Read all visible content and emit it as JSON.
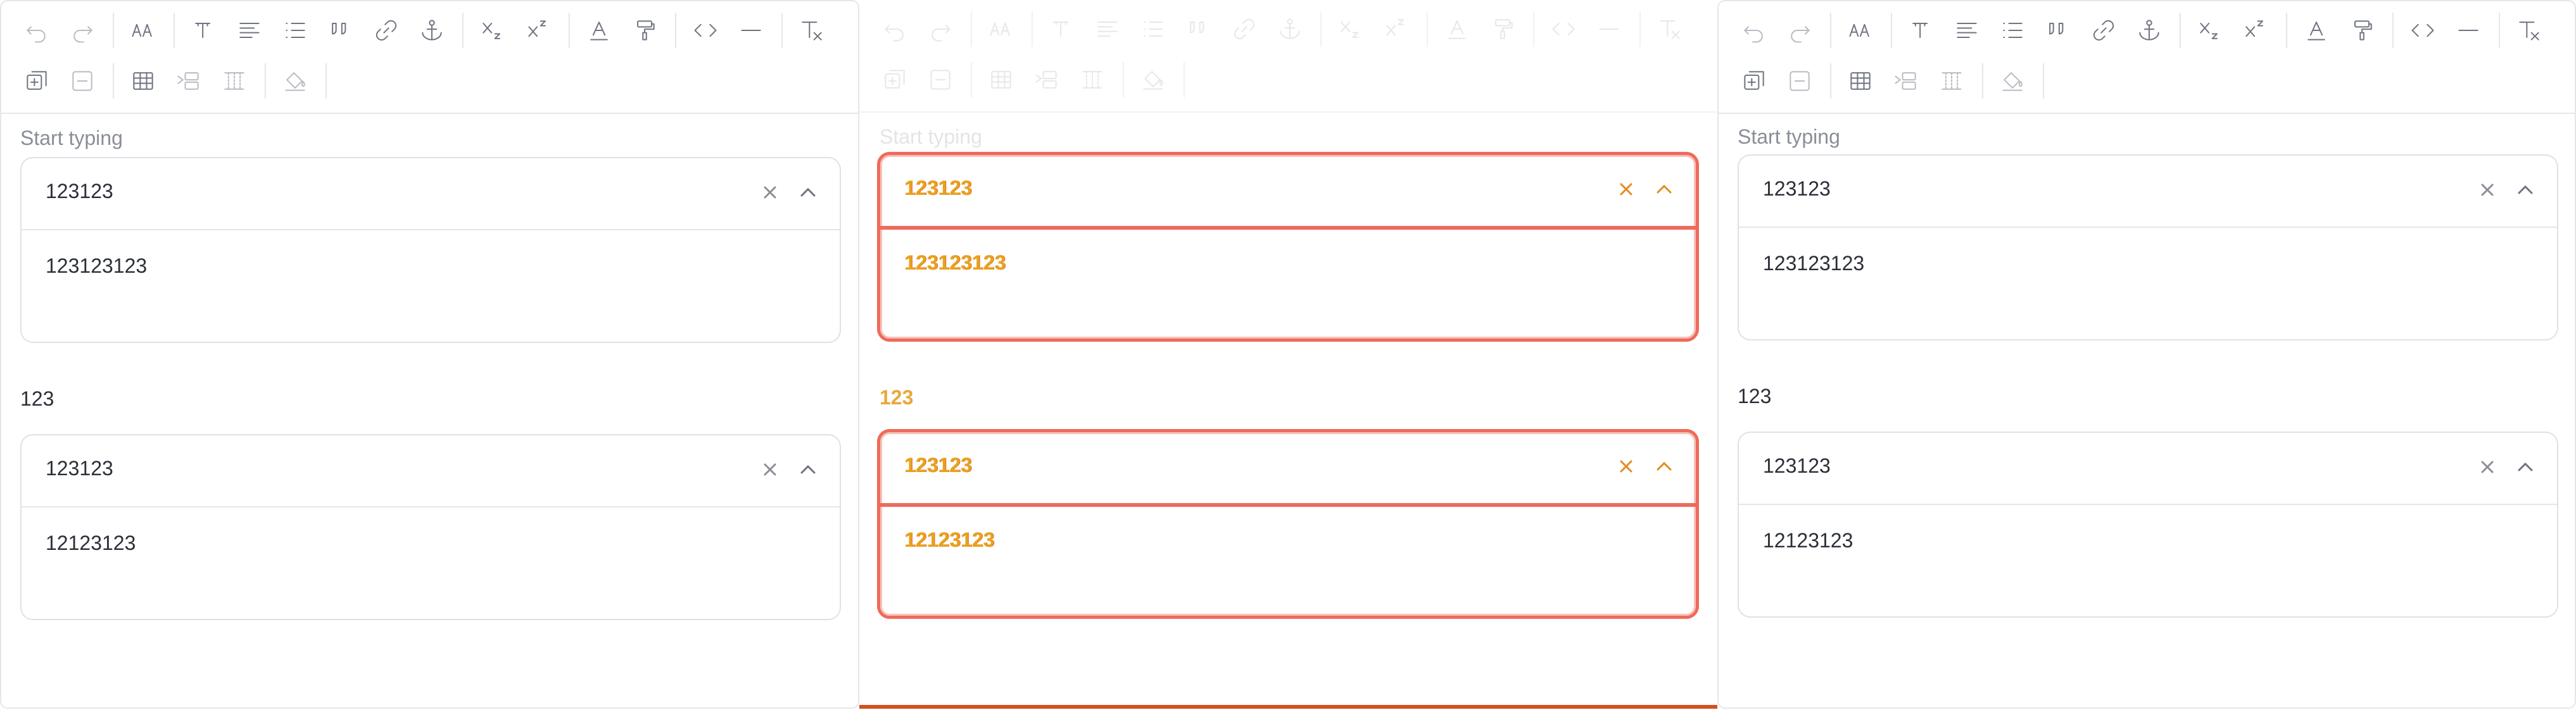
{
  "toolbar": {
    "row1": [
      {
        "icon": "undo-icon",
        "disabled": true
      },
      {
        "icon": "redo-icon",
        "disabled": true
      },
      {
        "sep": true
      },
      {
        "icon": "font-size-icon"
      },
      {
        "sep": true
      },
      {
        "icon": "text-style-icon"
      },
      {
        "icon": "align-icon"
      },
      {
        "icon": "bullet-list-icon"
      },
      {
        "icon": "quote-icon"
      },
      {
        "icon": "link-icon"
      },
      {
        "icon": "anchor-icon"
      },
      {
        "sep": true
      },
      {
        "icon": "subscript-icon"
      },
      {
        "icon": "superscript-icon"
      },
      {
        "sep": true
      },
      {
        "icon": "text-color-icon"
      },
      {
        "icon": "format-painter-icon"
      },
      {
        "sep": true
      },
      {
        "icon": "code-icon"
      },
      {
        "icon": "horizontal-rule-icon"
      },
      {
        "sep": true
      },
      {
        "icon": "clear-format-icon"
      }
    ],
    "row2": [
      {
        "icon": "add-block-icon"
      },
      {
        "icon": "remove-block-icon",
        "disabled": true
      },
      {
        "sep": true
      },
      {
        "icon": "table-icon"
      },
      {
        "icon": "insert-row-icon",
        "disabled": true
      },
      {
        "icon": "insert-column-icon",
        "disabled": true
      },
      {
        "sep": true
      },
      {
        "icon": "fill-color-icon",
        "disabled": true
      },
      {
        "sep": true
      }
    ]
  },
  "panels": [
    {
      "id": "left",
      "field1": {
        "label": "Start typing",
        "selected": "123123",
        "body": "123123123"
      },
      "field2": {
        "label": "123",
        "selected": "123123",
        "body": "12123123"
      }
    },
    {
      "id": "mid",
      "field1": {
        "label": "Start typing",
        "selected": "123123",
        "body": "123123123"
      },
      "field2": {
        "label": "123",
        "selected": "123123",
        "body": "12123123"
      }
    },
    {
      "id": "right",
      "field1": {
        "label": "Start typing",
        "selected": "123123",
        "body": "123123123"
      },
      "field2": {
        "label": "123",
        "selected": "123123",
        "body": "12123123"
      }
    }
  ]
}
